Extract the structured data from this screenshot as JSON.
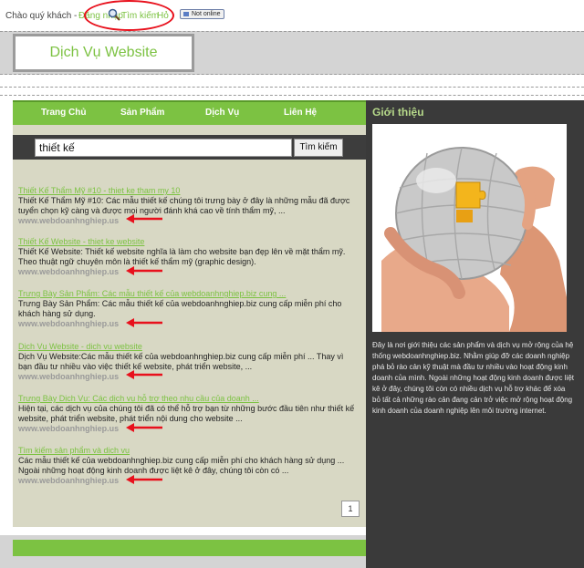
{
  "topbar": {
    "greeting": "Chào quý khách -",
    "login": "Đăng nhập",
    "search_link": "Tìm kiếm",
    "hd": "Hỏ",
    "online_badge": "Not online"
  },
  "header": {
    "site_title": "Dịch Vụ Website"
  },
  "nav": {
    "items": [
      {
        "label": "Trang Chủ"
      },
      {
        "label": "Sản Phẩm"
      },
      {
        "label": "Dịch Vụ"
      },
      {
        "label": "Liên Hệ"
      }
    ]
  },
  "search": {
    "value": "thiết kế",
    "button": "Tìm kiếm"
  },
  "results": [
    {
      "title": "Thiết Kế Thẩm Mỹ #10 - thiet ke tham my 10",
      "desc": "Thiết Kế Thẩm Mỹ #10: Các mẫu thiết kế chúng tôi trưng bày ở đây là những mẫu đã được tuyển chọn kỹ càng và được mọi người đánh khá cao về tính thẩm mỹ, ...",
      "url": "www.webdoanhnghiep.us"
    },
    {
      "title": "Thiết Kế Website - thiet ke website",
      "desc": "Thiết Kế Website: Thiết kế website nghĩa là làm cho website bạn đẹp lên về mặt thẩm mỹ. Theo thuật ngữ chuyên môn là thiết kế thẩm mỹ (graphic design).",
      "url": "www.webdoanhnghiep.us"
    },
    {
      "title": "Trưng Bày Sản Phẩm: Các mẫu thiết kế của webdoanhnghiep.biz cung ...",
      "desc": "Trưng Bày Sản Phẩm: Các mẫu thiết kế của webdoanhnghiep.biz cung cấp miễn phí cho khách hàng sử dụng.",
      "url": "www.webdoanhnghiep.us"
    },
    {
      "title": "Dịch Vụ Website - dich vu website",
      "desc": "Dịch Vụ Website:Các mẫu thiết kế của webdoanhnghiep.biz cung cấp miễn phí ... Thay vì bạn đầu tư nhiều vào việc thiết kế website, phát triển website, ...",
      "url": "www.webdoanhnghiep.us"
    },
    {
      "title": "Trưng Bày Dịch Vụ: Các dịch vụ hỗ trợ theo nhu cầu của doanh ...",
      "desc": "Hiện tại, các dịch vụ của chúng tôi đã có thể hỗ trợ bạn từ những bước đầu tiên như thiết kế website, phát triển website, phát triển nội dung cho website ...",
      "url": "www.webdoanhnghiep.us"
    },
    {
      "title": "Tìm kiếm sản phẩm và dịch vụ",
      "desc": "Các mẫu thiết kế của webdoanhnghiep.biz cung cấp miễn phí cho khách hàng sử dụng ... Ngoài những hoạt động kinh doanh được liệt kê ở đây, chúng tôi còn có ...",
      "url": "www.webdoanhnghiep.us"
    }
  ],
  "pager": {
    "current": "1"
  },
  "sidebar": {
    "title": "Giới thiệu",
    "text": "Đây là nơi giới thiệu các sản phẩm và dịch vụ mở rộng của hệ thống webdoanhnghiep.biz. Nhằm giúp đỡ các doanh nghiệp phá bỏ rào cản kỹ thuật mà đầu tư nhiều vào hoạt động kinh doanh của mình. Ngoài những hoạt động kinh doanh được liệt kê ở đây, chúng tôi còn có nhiều dịch vụ hỗ trợ khác để xóa bỏ tất cả những rào cản đang cản trở việc mở rộng hoạt động kinh doanh của doanh nghiệp lên môi trường internet."
  },
  "colors": {
    "accent_green": "#7cc242",
    "annotation_red": "#e8101c",
    "sidebar_bg": "#3a3a3a",
    "main_bg": "#d8d8c4"
  }
}
